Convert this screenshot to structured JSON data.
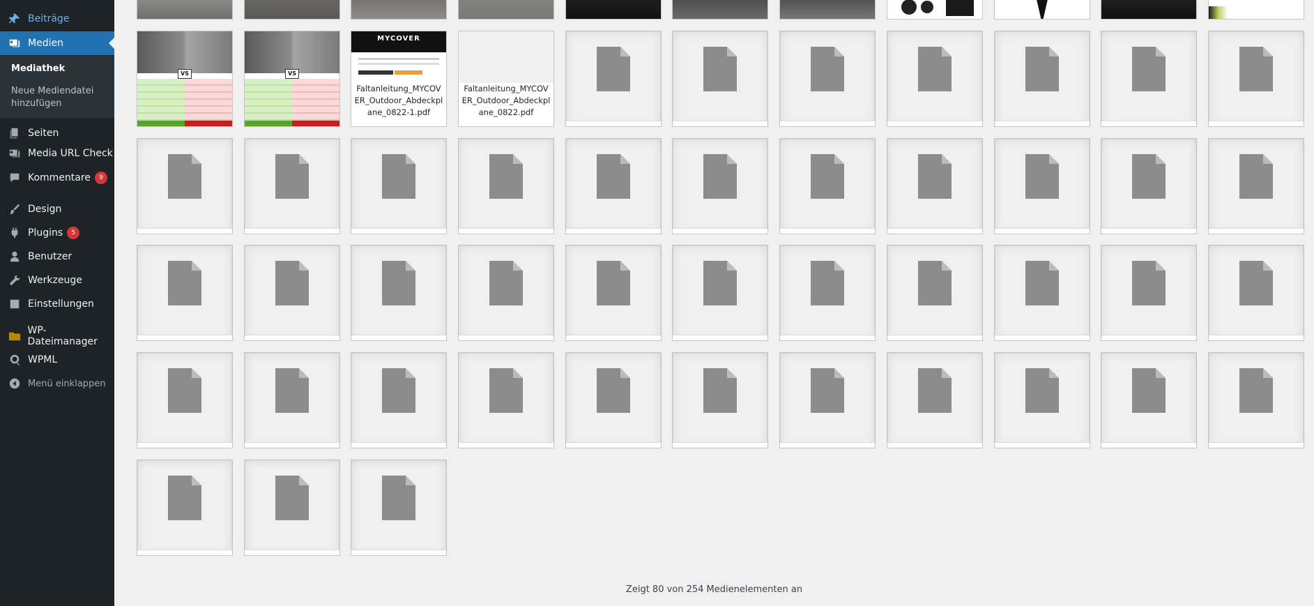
{
  "sidebar": {
    "items": [
      {
        "label": "Beiträge",
        "icon": "pin-icon"
      },
      {
        "label": "Medien",
        "icon": "media-icon"
      },
      {
        "label": "Seiten",
        "icon": "pages-icon"
      },
      {
        "label": "Media URL Check",
        "icon": "media-check-icon"
      },
      {
        "label": "Kommentare",
        "icon": "comments-icon",
        "badge": "9"
      },
      {
        "label": "Design",
        "icon": "brush-icon"
      },
      {
        "label": "Plugins",
        "icon": "plugin-icon",
        "badge": "5"
      },
      {
        "label": "Benutzer",
        "icon": "user-icon"
      },
      {
        "label": "Werkzeuge",
        "icon": "wrench-icon"
      },
      {
        "label": "Einstellungen",
        "icon": "settings-icon"
      },
      {
        "label": "WP-Dateimanager",
        "icon": "folder-icon"
      },
      {
        "label": "WPML",
        "icon": "wpml-icon"
      }
    ],
    "submenu": {
      "mediathek": "Mediathek",
      "add_new": "Neue Mediendatei hinzufügen"
    },
    "collapse_label": "Menü einklappen"
  },
  "media": {
    "pdf_items": [
      "Faltanleitung_MYCOVER_Outdoor_Abdeckplane_0822-1.pdf",
      "Faltanleitung_MYCOVER_Outdoor_Abdeckplane_0822.pdf"
    ],
    "mycover_logo": "MYCOVER",
    "vs_label": "VS"
  },
  "footer": {
    "count_text": "Zeigt 80 von 254 Medienelementen an"
  },
  "colors": {
    "sidebar_bg": "#1d2327",
    "accent": "#2271b1",
    "badge": "#d63638",
    "page_bg": "#f0f0f1",
    "doc_icon": "#8c8c8c"
  }
}
